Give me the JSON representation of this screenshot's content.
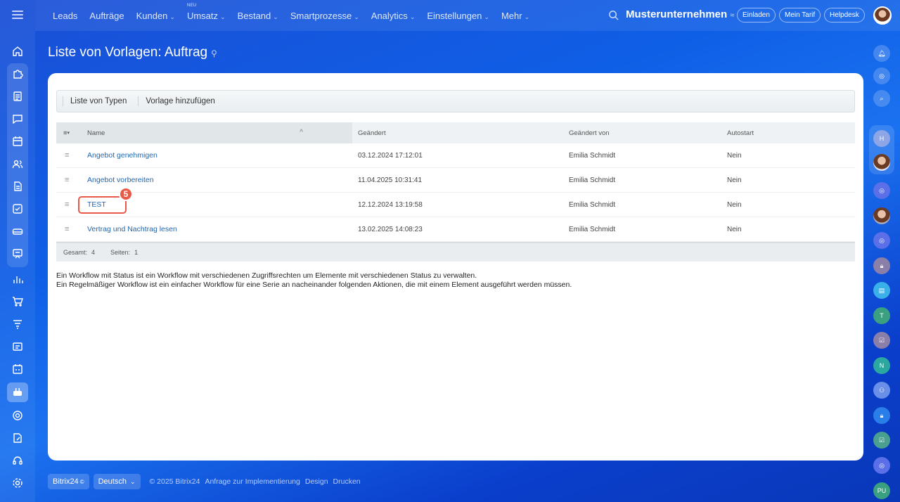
{
  "topbar": {
    "nav": [
      {
        "label": "Leads",
        "chevron": false,
        "badge": ""
      },
      {
        "label": "Aufträge",
        "chevron": false,
        "badge": ""
      },
      {
        "label": "Kunden",
        "chevron": true,
        "badge": ""
      },
      {
        "label": "Umsatz",
        "chevron": true,
        "badge": "NEU"
      },
      {
        "label": "Bestand",
        "chevron": true,
        "badge": ""
      },
      {
        "label": "Smartprozesse",
        "chevron": true,
        "badge": ""
      },
      {
        "label": "Analytics",
        "chevron": true,
        "badge": ""
      },
      {
        "label": "Einstellungen",
        "chevron": true,
        "badge": ""
      },
      {
        "label": "Mehr",
        "chevron": true,
        "badge": ""
      }
    ],
    "company": "Musterunternehmen",
    "buttons": {
      "invite": "Einladen",
      "plan": "Mein Tarif",
      "helpdesk": "Helpdesk"
    }
  },
  "page": {
    "title": "Liste von Vorlagen: Auftrag"
  },
  "toolbar": {
    "types_label": "Liste von Typen",
    "add_label": "Vorlage hinzufügen"
  },
  "grid": {
    "columns": {
      "name": "Name",
      "changed": "Geändert",
      "changed_by": "Geändert von",
      "autostart": "Autostart"
    },
    "rows": [
      {
        "name": "Angebot genehmigen",
        "changed": "03.12.2024 17:12:01",
        "changed_by": "Emilia Schmidt",
        "autostart": "Nein"
      },
      {
        "name": "Angebot vorbereiten",
        "changed": "11.04.2025 10:31:41",
        "changed_by": "Emilia Schmidt",
        "autostart": "Nein"
      },
      {
        "name": "TEST",
        "changed": "12.12.2024 13:19:58",
        "changed_by": "Emilia Schmidt",
        "autostart": "Nein"
      },
      {
        "name": "Vertrag und Nachtrag lesen",
        "changed": "13.02.2025 14:08:23",
        "changed_by": "Emilia Schmidt",
        "autostart": "Nein"
      }
    ],
    "footer": {
      "total_label": "Gesamt:",
      "total": "4",
      "pages_label": "Seiten:",
      "pages": "1"
    }
  },
  "step_badge": "5",
  "description": {
    "line1": "Ein Workflow mit Status ist ein Workflow mit verschiedenen Zugriffsrechten um Elemente mit verschiedenen Status zu verwalten.",
    "line2": "Ein Regelmäßiger Workflow ist ein einfacher Workflow für eine Serie an nacheinander folgenden Aktionen, die mit einem Element ausgeführt werden müssen."
  },
  "footer": {
    "brand": "Bitrix24",
    "language": "Deutsch",
    "copyright": "© 2025 Bitrix24",
    "links": [
      "Anfrage zur Implementierung",
      "Design",
      "Drucken"
    ]
  },
  "right_sidebar": {
    "initials": [
      "H",
      "T",
      "N",
      "PU"
    ]
  },
  "colors": {
    "accent": "#2067b0",
    "highlight": "#e85a47"
  }
}
